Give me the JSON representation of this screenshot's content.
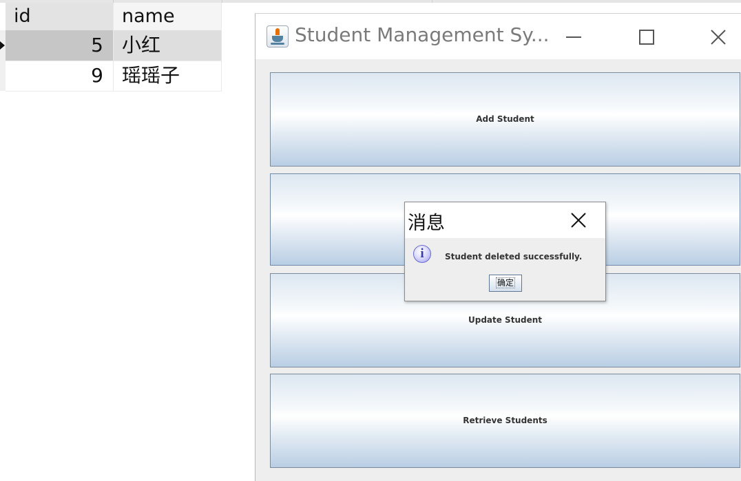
{
  "db_table": {
    "columns": [
      "id",
      "name"
    ],
    "rows": [
      {
        "id": "5",
        "name": "小红",
        "selected": true
      },
      {
        "id": "9",
        "name": "瑶瑶子",
        "selected": false
      }
    ]
  },
  "app_window": {
    "title": "Student Management Sy...",
    "icon": "java-coffee-cup-icon",
    "controls": [
      "minimize-icon",
      "maximize-icon",
      "close-icon"
    ],
    "buttons": [
      {
        "label": "Add Student"
      },
      {
        "label": ""
      },
      {
        "label": "Update Student"
      },
      {
        "label": "Retrieve Students"
      }
    ]
  },
  "dialog": {
    "title": "消息",
    "icon": "info-icon",
    "message": "Student deleted successfully.",
    "ok_label": "确定"
  }
}
